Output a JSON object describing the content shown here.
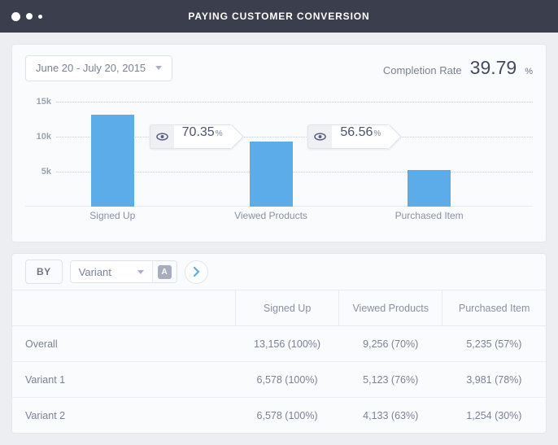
{
  "window": {
    "title": "Paying Customer Conversion",
    "dots": [
      "dot-large",
      "dot-medium",
      "dot-small"
    ]
  },
  "toolbar": {
    "date_range": "June 20 - July 20, 2015",
    "date_caret_icon": "chevron-down-icon",
    "completion_label": "Completion Rate",
    "completion_value": "39.79",
    "completion_unit": "%"
  },
  "chart_data": {
    "type": "bar",
    "title": "Paying Customer Conversion",
    "categories": [
      "Signed Up",
      "Viewed Products",
      "Purchased Item"
    ],
    "values": [
      13156,
      9256,
      5235
    ],
    "ylim": [
      0,
      16500
    ],
    "yticks": [
      5000,
      10000,
      15000
    ],
    "ytick_labels": [
      "5k",
      "10k",
      "15k"
    ],
    "xlabel": "",
    "ylabel": "",
    "grid": true,
    "legend": "none",
    "bar_color": "#5bace8",
    "step_conversions": [
      {
        "value": "70.35",
        "unit": "%",
        "icon": "eye-icon"
      },
      {
        "value": "56.56",
        "unit": "%",
        "icon": "eye-icon"
      }
    ]
  },
  "controls": {
    "by_label": "BY",
    "dimension": "Variant",
    "dimension_caret_icon": "chevron-down-icon",
    "variant_badge": "A",
    "next_icon": "chevron-right-icon"
  },
  "table": {
    "columns": [
      "",
      "Signed Up",
      "Viewed Products",
      "Purchased Item"
    ],
    "rows": [
      {
        "label": "Overall",
        "cells": [
          "13,156 (100%)",
          "9,256 (70%)",
          "5,235 (57%)"
        ]
      },
      {
        "label": "Variant 1",
        "cells": [
          "6,578 (100%)",
          "5,123 (76%)",
          "3,981 (78%)"
        ]
      },
      {
        "label": "Variant 2",
        "cells": [
          "6,578 (100%)",
          "4,133 (63%)",
          "1,254 (30%)"
        ]
      }
    ]
  }
}
